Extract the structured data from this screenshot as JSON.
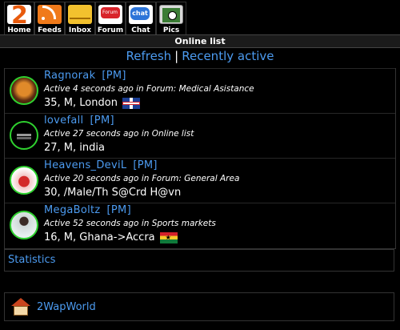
{
  "nav": [
    {
      "label": "Home",
      "icon": "home-2-icon"
    },
    {
      "label": "Feeds",
      "icon": "rss-feed-icon"
    },
    {
      "label": "Inbox",
      "icon": "envelope-icon"
    },
    {
      "label": "Forum",
      "icon": "forum-icon"
    },
    {
      "label": "Chat",
      "icon": "chat-bubble-icon"
    },
    {
      "label": "Pics",
      "icon": "picture-icon"
    }
  ],
  "page_title": "Online list",
  "links": {
    "refresh": "Refresh",
    "separator": "|",
    "recent": "Recently active"
  },
  "users": [
    {
      "name": "Ragnorak",
      "pm": "[PM]",
      "activity": "Active 4 seconds ago  in Forum: Medical Asistance",
      "info": "35, M, London",
      "flag": "uk-flag-icon"
    },
    {
      "name": "lovefall",
      "pm": "[PM]",
      "activity": "Active 27 seconds ago  in Online list",
      "info": "27, M, india",
      "flag": ""
    },
    {
      "name": "Heavens_DeviL",
      "pm": "[PM]",
      "activity": "Active 20 seconds ago  in Forum: General Area",
      "info": "30, /Male/Th S@Crd H@vn",
      "flag": ""
    },
    {
      "name": "MegaBoltz",
      "pm": "[PM]",
      "activity": "Active 52 seconds ago  in Sports markets",
      "info": "16, M, Ghana->Accra",
      "flag": "ghana-flag-icon"
    }
  ],
  "statistics": "Statistics",
  "footer_link": "2WapWorld",
  "colors": {
    "link": "#4c9bf0",
    "background": "#000000",
    "avatar_border": "#2fd12f"
  }
}
